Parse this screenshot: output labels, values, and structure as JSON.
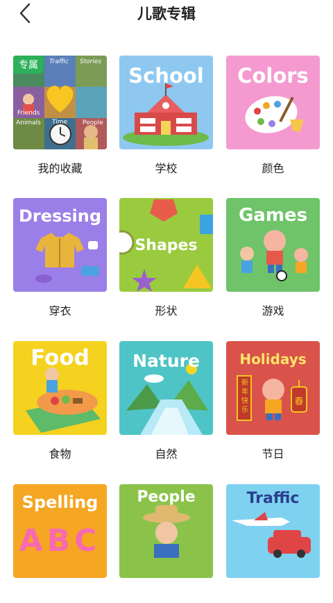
{
  "header": {
    "title": "儿歌专辑"
  },
  "cards": [
    {
      "id": "favorites",
      "label": "我的收藏",
      "badge": "专属",
      "colors": {
        "bg": "#3a6f56"
      },
      "mini": [
        "Traffic",
        "Stories",
        "Friends",
        "Animals",
        "Time",
        "People"
      ]
    },
    {
      "id": "school",
      "label": "学校",
      "word": "School",
      "colors": {
        "bg": "#8ec8f0"
      }
    },
    {
      "id": "colors",
      "label": "颜色",
      "word": "Colors",
      "colors": {
        "bg": "#f59ad0"
      }
    },
    {
      "id": "dressing",
      "label": "穿衣",
      "word": "Dressing",
      "colors": {
        "bg": "#9b7fe8"
      }
    },
    {
      "id": "shapes",
      "label": "形状",
      "word": "Shapes",
      "colors": {
        "bg": "#9acb3e"
      }
    },
    {
      "id": "games",
      "label": "游戏",
      "word": "Games",
      "colors": {
        "bg": "#6fc46a"
      }
    },
    {
      "id": "food",
      "label": "食物",
      "word": "Food",
      "colors": {
        "bg": "#f4d21f"
      }
    },
    {
      "id": "nature",
      "label": "自然",
      "word": "Nature",
      "colors": {
        "bg": "#4fc4c6"
      }
    },
    {
      "id": "holidays",
      "label": "节日",
      "word": "Holidays",
      "colors": {
        "bg": "#d9534a"
      },
      "signs": [
        "新年快乐",
        "春"
      ]
    },
    {
      "id": "spelling",
      "label": "",
      "word": "Spelling",
      "colors": {
        "bg": "#f5a623"
      },
      "letters": "ABC"
    },
    {
      "id": "people",
      "label": "",
      "word": "People",
      "colors": {
        "bg": "#8bc34a"
      }
    },
    {
      "id": "traffic",
      "label": "",
      "word": "Traffic",
      "colors": {
        "bg": "#7fd1f0"
      }
    }
  ]
}
